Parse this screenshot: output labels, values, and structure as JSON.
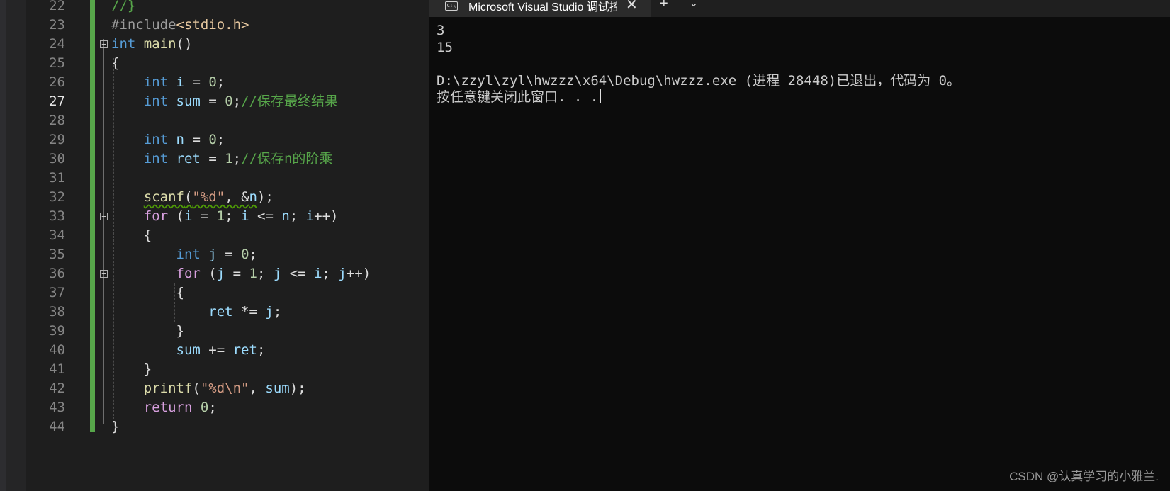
{
  "editor": {
    "lines": [
      {
        "no": "22",
        "tokens": [
          {
            "t": "//}",
            "c": "cmt"
          }
        ]
      },
      {
        "no": "23",
        "tokens": [
          {
            "t": "#include",
            "c": "pp"
          },
          {
            "t": "<stdio.h>",
            "c": "hdr"
          }
        ]
      },
      {
        "no": "24",
        "tokens": [
          {
            "t": "int",
            "c": "kw"
          },
          {
            "t": " "
          },
          {
            "t": "main",
            "c": "fn"
          },
          {
            "t": "()"
          }
        ]
      },
      {
        "no": "25",
        "tokens": [
          {
            "t": "{"
          }
        ]
      },
      {
        "no": "26",
        "tokens": [
          {
            "t": "    "
          },
          {
            "t": "int",
            "c": "kw"
          },
          {
            "t": " "
          },
          {
            "t": "i",
            "c": "var"
          },
          {
            "t": " = "
          },
          {
            "t": "0",
            "c": "num"
          },
          {
            "t": ";"
          }
        ]
      },
      {
        "no": "27",
        "tokens": [
          {
            "t": "    "
          },
          {
            "t": "int",
            "c": "kw"
          },
          {
            "t": " "
          },
          {
            "t": "sum",
            "c": "var"
          },
          {
            "t": " = "
          },
          {
            "t": "0",
            "c": "num"
          },
          {
            "t": ";"
          },
          {
            "t": "//保存最终结果",
            "c": "cmt"
          }
        ]
      },
      {
        "no": "28",
        "tokens": []
      },
      {
        "no": "29",
        "tokens": [
          {
            "t": "    "
          },
          {
            "t": "int",
            "c": "kw"
          },
          {
            "t": " "
          },
          {
            "t": "n",
            "c": "var"
          },
          {
            "t": " = "
          },
          {
            "t": "0",
            "c": "num"
          },
          {
            "t": ";"
          }
        ]
      },
      {
        "no": "30",
        "tokens": [
          {
            "t": "    "
          },
          {
            "t": "int",
            "c": "kw"
          },
          {
            "t": " "
          },
          {
            "t": "ret",
            "c": "var"
          },
          {
            "t": " = "
          },
          {
            "t": "1",
            "c": "num"
          },
          {
            "t": ";"
          },
          {
            "t": "//保存n的阶乘",
            "c": "cmt"
          }
        ]
      },
      {
        "no": "31",
        "tokens": []
      },
      {
        "no": "32",
        "tokens": [
          {
            "t": "    "
          },
          {
            "t": "scanf",
            "c": "fn wavy"
          },
          {
            "t": "(",
            "c": "wavy"
          },
          {
            "t": "\"%d\"",
            "c": "str wavy"
          },
          {
            "t": ", &",
            "c": "wavy"
          },
          {
            "t": "n",
            "c": "var wavy"
          },
          {
            "t": ");"
          }
        ]
      },
      {
        "no": "33",
        "tokens": [
          {
            "t": "    "
          },
          {
            "t": "for",
            "c": "ctl"
          },
          {
            "t": " ("
          },
          {
            "t": "i",
            "c": "var"
          },
          {
            "t": " = "
          },
          {
            "t": "1",
            "c": "num"
          },
          {
            "t": "; "
          },
          {
            "t": "i",
            "c": "var"
          },
          {
            "t": " <= "
          },
          {
            "t": "n",
            "c": "var"
          },
          {
            "t": "; "
          },
          {
            "t": "i",
            "c": "var"
          },
          {
            "t": "++)"
          }
        ]
      },
      {
        "no": "34",
        "tokens": [
          {
            "t": "    {"
          }
        ]
      },
      {
        "no": "35",
        "tokens": [
          {
            "t": "        "
          },
          {
            "t": "int",
            "c": "kw"
          },
          {
            "t": " "
          },
          {
            "t": "j",
            "c": "var"
          },
          {
            "t": " = "
          },
          {
            "t": "0",
            "c": "num"
          },
          {
            "t": ";"
          }
        ]
      },
      {
        "no": "36",
        "tokens": [
          {
            "t": "        "
          },
          {
            "t": "for",
            "c": "ctl"
          },
          {
            "t": " ("
          },
          {
            "t": "j",
            "c": "var"
          },
          {
            "t": " = "
          },
          {
            "t": "1",
            "c": "num"
          },
          {
            "t": "; "
          },
          {
            "t": "j",
            "c": "var"
          },
          {
            "t": " <= "
          },
          {
            "t": "i",
            "c": "var"
          },
          {
            "t": "; "
          },
          {
            "t": "j",
            "c": "var"
          },
          {
            "t": "++)"
          }
        ]
      },
      {
        "no": "37",
        "tokens": [
          {
            "t": "        {"
          }
        ]
      },
      {
        "no": "38",
        "tokens": [
          {
            "t": "            "
          },
          {
            "t": "ret",
            "c": "var"
          },
          {
            "t": " *= "
          },
          {
            "t": "j",
            "c": "var"
          },
          {
            "t": ";"
          }
        ]
      },
      {
        "no": "39",
        "tokens": [
          {
            "t": "        }"
          }
        ]
      },
      {
        "no": "40",
        "tokens": [
          {
            "t": "        "
          },
          {
            "t": "sum",
            "c": "var"
          },
          {
            "t": " += "
          },
          {
            "t": "ret",
            "c": "var"
          },
          {
            "t": ";"
          }
        ]
      },
      {
        "no": "41",
        "tokens": [
          {
            "t": "    }"
          }
        ]
      },
      {
        "no": "42",
        "tokens": [
          {
            "t": "    "
          },
          {
            "t": "printf",
            "c": "fn"
          },
          {
            "t": "("
          },
          {
            "t": "\"%d\\n\"",
            "c": "str"
          },
          {
            "t": ", "
          },
          {
            "t": "sum",
            "c": "var"
          },
          {
            "t": ");"
          }
        ]
      },
      {
        "no": "43",
        "tokens": [
          {
            "t": "    "
          },
          {
            "t": "return",
            "c": "ctl"
          },
          {
            "t": " "
          },
          {
            "t": "0",
            "c": "num"
          },
          {
            "t": ";"
          }
        ]
      },
      {
        "no": "44",
        "tokens": [
          {
            "t": "}"
          }
        ]
      }
    ],
    "active_line": "27",
    "fold_lines": [
      "24",
      "33",
      "36"
    ]
  },
  "console": {
    "tab_title": "Microsoft Visual Studio 调试控制台",
    "tab_icon_text": "C:\\",
    "close_glyph": "✕",
    "new_tab_glyph": "+",
    "dropdown_glyph": "⌄",
    "output": {
      "line1": "3",
      "line2": "15",
      "line3": "",
      "line4": "D:\\zzyl\\zyl\\hwzzz\\x64\\Debug\\hwzzz.exe (进程 28448)已退出，代码为 0。",
      "line5": "按任意键关闭此窗口. . ."
    }
  },
  "watermark": "CSDN @认真学习的小雅兰."
}
